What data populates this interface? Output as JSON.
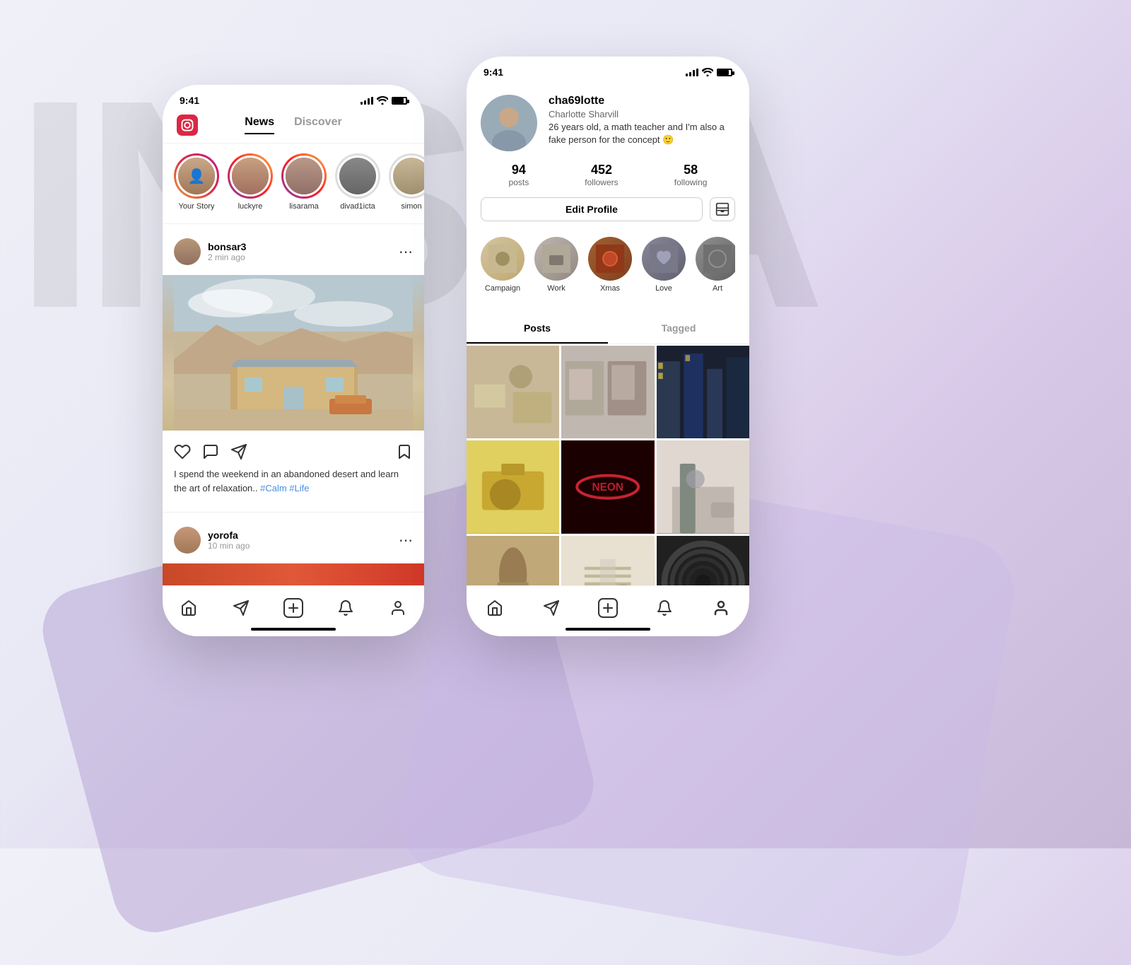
{
  "background": {
    "letters": "INSTA"
  },
  "phone_left": {
    "status_bar": {
      "time": "9:41"
    },
    "nav": {
      "logo_alt": "Instagram",
      "tabs": [
        {
          "label": "News",
          "active": true
        },
        {
          "label": "Discover",
          "active": false
        }
      ]
    },
    "stories": [
      {
        "label": "Your Story",
        "gradient": "orange",
        "id": "your-story"
      },
      {
        "label": "luckyre",
        "gradient": "purple",
        "id": "luckyre"
      },
      {
        "label": "lisarama",
        "gradient": "purple",
        "id": "lisarama"
      },
      {
        "label": "divad1icta",
        "gradient": "none",
        "id": "divad1icta"
      },
      {
        "label": "simon",
        "gradient": "none",
        "id": "simon"
      }
    ],
    "post1": {
      "username": "bonsar3",
      "time": "2 min ago",
      "caption": "I spend the weekend in an abandoned desert and learn the art of relaxation.. ",
      "caption_tags": "#Calm #Life"
    },
    "post2": {
      "username": "yorofa",
      "time": "10 min ago"
    },
    "bottom_nav": {
      "items": [
        "home",
        "send",
        "add",
        "bell",
        "profile"
      ]
    }
  },
  "phone_right": {
    "status_bar": {
      "time": "9:41"
    },
    "profile": {
      "username": "cha69lotte",
      "full_name": "Charlotte Sharvill",
      "bio": "26 years old, a math teacher and I'm also a fake person for the concept 🙂",
      "posts_count": "94",
      "posts_label": "posts",
      "followers_count": "452",
      "followers_label": "followers",
      "following_count": "58",
      "following_label": "following"
    },
    "edit_profile_btn": "Edit Profile",
    "highlights": [
      {
        "label": "Campaign"
      },
      {
        "label": "Work"
      },
      {
        "label": "Xmas"
      },
      {
        "label": "Love"
      },
      {
        "label": "Art"
      }
    ],
    "tabs": [
      {
        "label": "Posts",
        "active": true
      },
      {
        "label": "Tagged",
        "active": false
      }
    ],
    "grid_cells": [
      "gc-1",
      "gc-2",
      "gc-3",
      "gc-4",
      "gc-5",
      "gc-6",
      "gc-7",
      "gc-8",
      "gc-9",
      "gc-10",
      "gc-11",
      "gc-12"
    ],
    "bottom_nav": {
      "items": [
        "home",
        "send",
        "add",
        "bell",
        "profile"
      ]
    }
  }
}
